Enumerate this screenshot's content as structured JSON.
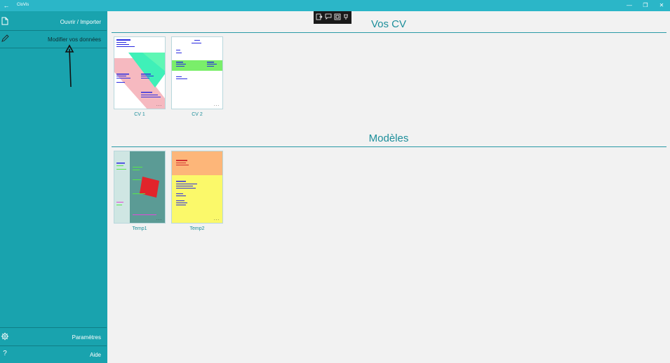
{
  "window": {
    "title": "CloVis",
    "back_icon": "back-arrow-icon",
    "minimize_icon": "minimize-icon",
    "restore_icon": "restore-icon",
    "close_icon": "close-icon"
  },
  "sidebar": {
    "items": [
      {
        "label": "Ouvrir / Importer",
        "icon": "document-icon"
      },
      {
        "label": "Modifier vos données",
        "icon": "pencil-icon"
      }
    ],
    "bottom_items": [
      {
        "label": "Paramètres",
        "icon": "gear-icon"
      },
      {
        "label": "Aide",
        "icon": "help-icon"
      }
    ]
  },
  "sections": {
    "cvs": {
      "title": "Vos CV",
      "cards": [
        {
          "label": "CV 1",
          "more": "..."
        },
        {
          "label": "CV 2",
          "more": "..."
        }
      ]
    },
    "templates": {
      "title": "Modèles",
      "cards": [
        {
          "label": "Temp1",
          "more": "..."
        },
        {
          "label": "Temp2",
          "more": "..."
        }
      ]
    }
  },
  "colors": {
    "titlebar": "#2bb6c8",
    "sidebar": "#19a3ae",
    "accent": "#1c8e9a"
  }
}
